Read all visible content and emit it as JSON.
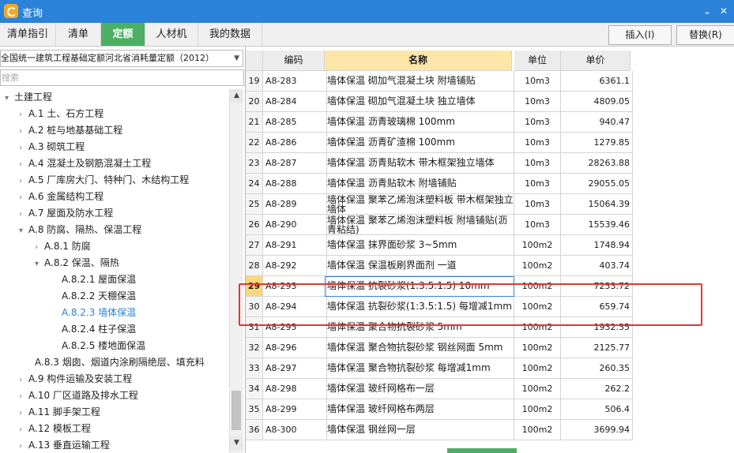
{
  "window": {
    "title": "查询",
    "collapse_icon": "chevron-down-icon",
    "close_icon": "close-icon"
  },
  "tabs": [
    {
      "label": "清单指引",
      "active": false
    },
    {
      "label": "清单",
      "active": false
    },
    {
      "label": "定额",
      "active": true
    },
    {
      "label": "人材机",
      "active": false
    },
    {
      "label": "我的数据",
      "active": false
    }
  ],
  "toolbar": {
    "insert_label": "插入(I)",
    "replace_label": "替换(R)"
  },
  "left": {
    "quota_select": "全国统一建筑工程基础定额河北省消耗量定额（2012）",
    "search_placeholder": "搜索",
    "tree": [
      {
        "label": "土建工程",
        "level": 0,
        "caret": "▾"
      },
      {
        "label": "A.1 土、石方工程",
        "level": 1,
        "caret": "›"
      },
      {
        "label": "A.2 桩与地基基础工程",
        "level": 1,
        "caret": "›"
      },
      {
        "label": "A.3 砌筑工程",
        "level": 1,
        "caret": "›"
      },
      {
        "label": "A.4 混凝土及钢筋混凝土工程",
        "level": 1,
        "caret": "›"
      },
      {
        "label": "A.5 厂库房大门、特种门、木结构工程",
        "level": 1,
        "caret": "›"
      },
      {
        "label": "A.6 金属结构工程",
        "level": 1,
        "caret": "›"
      },
      {
        "label": "A.7 屋面及防水工程",
        "level": 1,
        "caret": "›"
      },
      {
        "label": "A.8 防腐、隔热、保温工程",
        "level": 1,
        "caret": "▾"
      },
      {
        "label": "A.8.1 防腐",
        "level": 2,
        "caret": "›"
      },
      {
        "label": "A.8.2 保温、隔热",
        "level": 2,
        "caret": "▾"
      },
      {
        "label": "A.8.2.1 屋面保温",
        "level": 3,
        "caret": ""
      },
      {
        "label": "A.8.2.2 天棚保温",
        "level": 3,
        "caret": ""
      },
      {
        "label": "A.8.2.3 墙体保温",
        "level": 3,
        "caret": "",
        "selected": true
      },
      {
        "label": "A.8.2.4 柱子保温",
        "level": 3,
        "caret": ""
      },
      {
        "label": "A.8.2.5 楼地面保温",
        "level": 3,
        "caret": ""
      },
      {
        "label": "A.8.3 烟囱、烟道内涂刷隔绝层、填充料",
        "level": 2,
        "caret": ""
      },
      {
        "label": "A.9 构件运输及安装工程",
        "level": 1,
        "caret": "›"
      },
      {
        "label": "A.10 厂区道路及排水工程",
        "level": 1,
        "caret": "›"
      },
      {
        "label": "A.11 脚手架工程",
        "level": 1,
        "caret": "›"
      },
      {
        "label": "A.12 模板工程",
        "level": 1,
        "caret": "›"
      },
      {
        "label": "A.13 垂直运输工程",
        "level": 1,
        "caret": "›"
      }
    ]
  },
  "grid": {
    "headers": {
      "idx": "",
      "code": "编码",
      "name": "名称",
      "unit": "单位",
      "price": "单价"
    },
    "rows": [
      {
        "idx": "19",
        "code": "A8-283",
        "name": "墙体保温 砌加气混凝土块 附墙铺贴",
        "unit": "10m3",
        "price": "6361.1"
      },
      {
        "idx": "20",
        "code": "A8-284",
        "name": "墙体保温 砌加气混凝土块 独立墙体",
        "unit": "10m3",
        "price": "4809.05"
      },
      {
        "idx": "21",
        "code": "A8-285",
        "name": "墙体保温 沥青玻璃棉 100mm",
        "unit": "10m3",
        "price": "940.47"
      },
      {
        "idx": "22",
        "code": "A8-286",
        "name": "墙体保温 沥青矿渣棉 100mm",
        "unit": "10m3",
        "price": "1279.85"
      },
      {
        "idx": "23",
        "code": "A8-287",
        "name": "墙体保温 沥青贴软木 带木框架独立墙体",
        "unit": "10m3",
        "price": "28263.88"
      },
      {
        "idx": "24",
        "code": "A8-288",
        "name": "墙体保温 沥青贴软木 附墙铺贴",
        "unit": "10m3",
        "price": "29055.05"
      },
      {
        "idx": "25",
        "code": "A8-289",
        "name": "墙体保温 聚苯乙烯泡沫塑料板 带木框架独立墙体",
        "unit": "10m3",
        "price": "15064.39",
        "wrap": true
      },
      {
        "idx": "26",
        "code": "A8-290",
        "name": "墙体保温 聚苯乙烯泡沫塑料板 附墙铺贴(沥青粘结)",
        "unit": "10m3",
        "price": "15539.46",
        "wrap": true
      },
      {
        "idx": "27",
        "code": "A8-291",
        "name": "墙体保温 抹界面砂浆 3~5mm",
        "unit": "100m2",
        "price": "1748.94"
      },
      {
        "idx": "28",
        "code": "A8-292",
        "name": "墙体保温 保温板刷界面剂 一道",
        "unit": "100m2",
        "price": "403.74"
      },
      {
        "idx": "29",
        "code": "A8-293",
        "name": "墙体保温 抗裂砂浆(1:3.5:1.5) 10mm",
        "unit": "100m2",
        "price": "7253.72",
        "current": true
      },
      {
        "idx": "30",
        "code": "A8-294",
        "name": "墙体保温 抗裂砂浆(1:3.5:1.5) 每增减1mm",
        "unit": "100m2",
        "price": "659.74"
      },
      {
        "idx": "31",
        "code": "A8-295",
        "name": "墙体保温 聚合物抗裂砂浆 5mm",
        "unit": "100m2",
        "price": "1932.35"
      },
      {
        "idx": "32",
        "code": "A8-296",
        "name": "墙体保温 聚合物抗裂砂浆 钢丝网面 5mm",
        "unit": "100m2",
        "price": "2125.77"
      },
      {
        "idx": "33",
        "code": "A8-297",
        "name": "墙体保温 聚合物抗裂砂浆 每增减1mm",
        "unit": "100m2",
        "price": "260.35"
      },
      {
        "idx": "34",
        "code": "A8-298",
        "name": "墙体保温 玻纤网格布一层",
        "unit": "100m2",
        "price": "262.2"
      },
      {
        "idx": "35",
        "code": "A8-299",
        "name": "墙体保温 玻纤网格布两层",
        "unit": "100m2",
        "price": "506.4"
      },
      {
        "idx": "36",
        "code": "A8-300",
        "name": "墙体保温 钢丝网一层",
        "unit": "100m2",
        "price": "3699.94"
      }
    ]
  },
  "colors": {
    "titlebar": "#2a83d9",
    "active_tab": "#4caf64",
    "highlight_box": "#e0383a",
    "name_header": "#fde7a8"
  }
}
